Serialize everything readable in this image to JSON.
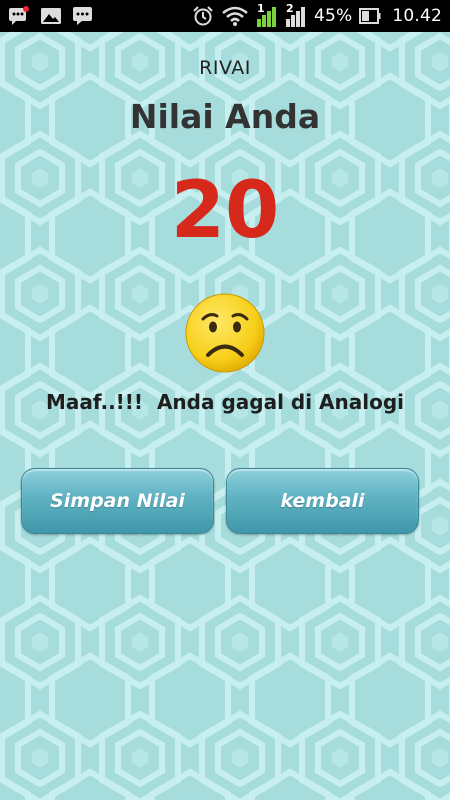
{
  "status_bar": {
    "battery_percent": "45%",
    "time": "10.42",
    "sim_1_label": "1",
    "sim_2_label": "2",
    "icons": [
      "bbm-notification-icon",
      "gallery-icon",
      "chat-icon",
      "alarm-icon",
      "wifi-icon",
      "signal-icon",
      "signal-icon",
      "battery-icon"
    ]
  },
  "result": {
    "username": "RIVAI",
    "title": "Nilai Anda",
    "score": "20",
    "emoji": "sad-face-icon",
    "message": "Maaf..!!!  Anda gagal di Analogi"
  },
  "actions": {
    "save_label": "Simpan Nilai",
    "back_label": "kembali"
  },
  "colors": {
    "background": "#a8e0e0",
    "score": "#d6291c",
    "button": "#5fb2c2"
  }
}
